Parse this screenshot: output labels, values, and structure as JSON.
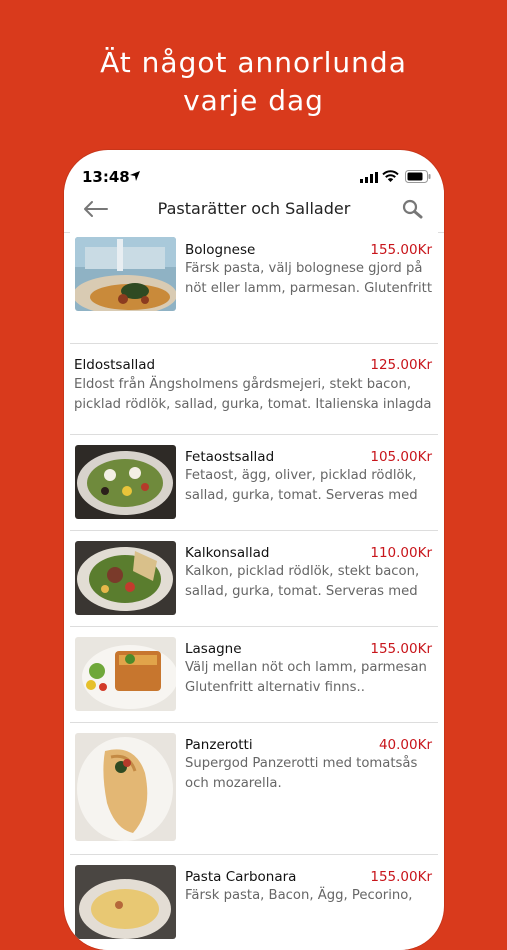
{
  "headline": {
    "line1": "Ät något annorlunda",
    "line2": "varje dag"
  },
  "status": {
    "time": "13:48"
  },
  "nav": {
    "title": "Pastarätter och Sallader"
  },
  "colors": {
    "background": "#d93a1c",
    "price": "#c8151b"
  },
  "menu": [
    {
      "name": "Bolognese",
      "price": "155.00Kr",
      "desc1": "Färsk pasta, välj bolognese gjord på",
      "desc2": "nöt eller lamm, parmesan. Glutenfritt"
    },
    {
      "name": "Eldostsallad",
      "price": "125.00Kr",
      "desc1": "Eldost från Ängsholmens gårdsmejeri, stekt bacon,",
      "desc2": "picklad rödlök, sallad, gurka, tomat. Italienska inlagda"
    },
    {
      "name": "Fetaostsallad",
      "price": "105.00Kr",
      "desc1": "Fetaost, ägg, oliver, picklad rödlök,",
      "desc2": "sallad, gurka, tomat. Serveras med"
    },
    {
      "name": "Kalkonsallad",
      "price": "110.00Kr",
      "desc1": "Kalkon, picklad rödlök, stekt bacon,",
      "desc2": "sallad, gurka, tomat. Serveras med"
    },
    {
      "name": "Lasagne",
      "price": "155.00Kr",
      "desc1": "Välj mellan nöt och lamm, parmesan",
      "desc2": "Glutenfritt alternativ finns.."
    },
    {
      "name": "Panzerotti",
      "price": "40.00Kr",
      "desc1": "Supergod Panzerotti med tomatsås",
      "desc2": "och mozarella."
    },
    {
      "name": "Pasta Carbonara",
      "price": "155.00Kr",
      "desc1": "Färsk pasta, Bacon, Ägg, Pecorino,",
      "desc2": ""
    }
  ]
}
